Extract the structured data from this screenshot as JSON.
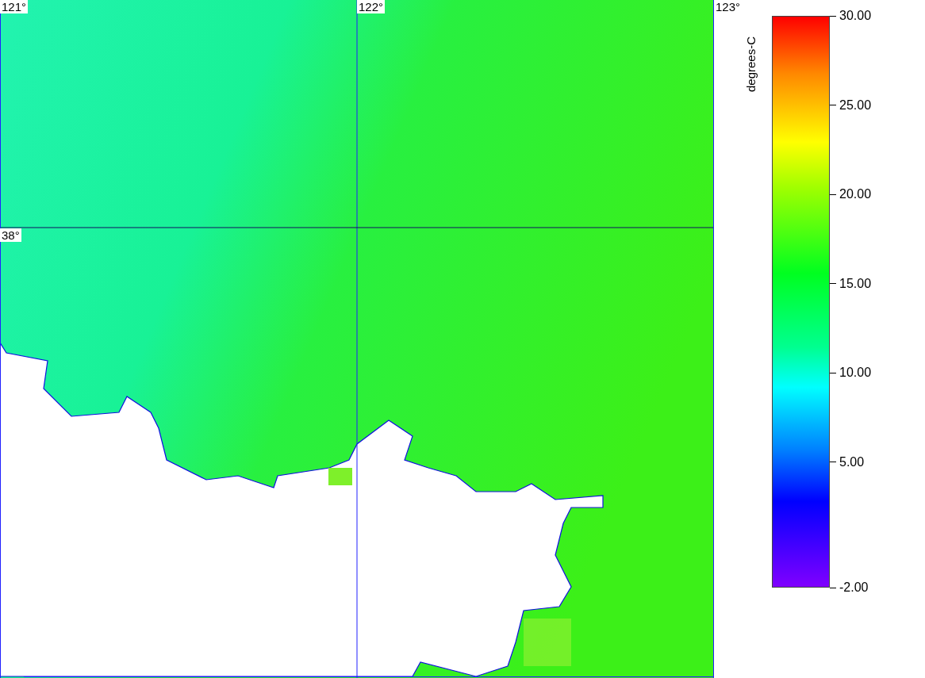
{
  "map": {
    "longitude_labels": [
      "121°",
      "122°",
      "123°"
    ],
    "latitude_labels": [
      "38°"
    ]
  },
  "colorbar": {
    "unit": "degrees-C",
    "ticks": [
      "30.00",
      "25.00",
      "20.00",
      "15.00",
      "10.00",
      "5.00",
      "-2.00"
    ]
  }
}
